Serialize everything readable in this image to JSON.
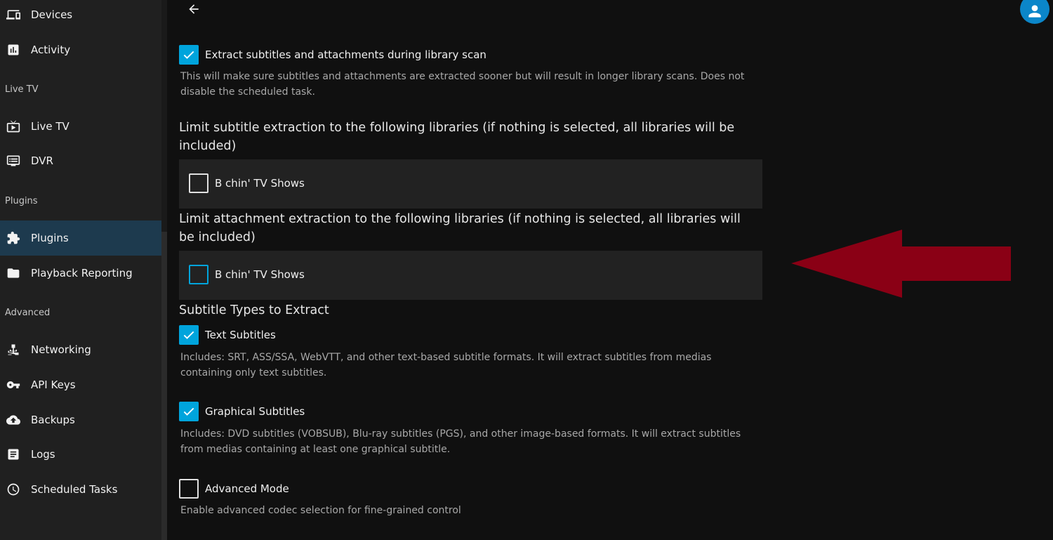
{
  "sidebar": {
    "items": [
      {
        "label": "Devices",
        "icon": "devices-icon"
      },
      {
        "label": "Activity",
        "icon": "activity-icon"
      },
      {
        "label": "Live TV",
        "icon": "live-tv-icon"
      },
      {
        "label": "DVR",
        "icon": "dvr-icon"
      },
      {
        "label": "Plugins",
        "icon": "puzzle-icon"
      },
      {
        "label": "Playback Reporting",
        "icon": "folder-icon"
      },
      {
        "label": "Networking",
        "icon": "network-icon"
      },
      {
        "label": "API Keys",
        "icon": "key-icon"
      },
      {
        "label": "Backups",
        "icon": "cloud-upload-icon"
      },
      {
        "label": "Logs",
        "icon": "document-icon"
      },
      {
        "label": "Scheduled Tasks",
        "icon": "clock-icon"
      }
    ],
    "sections": {
      "live_tv": "Live TV",
      "plugins": "Plugins",
      "advanced": "Advanced"
    },
    "active_item": "Plugins"
  },
  "main": {
    "extract_during_scan": {
      "label": "Extract subtitles and attachments during library scan",
      "checked": true,
      "description": "This will make sure subtitles and attachments are extracted sooner but will result in longer library scans. Does not disable the scheduled task."
    },
    "subtitle_limit_heading": "Limit subtitle extraction to the following libraries (if nothing is selected, all libraries will be included)",
    "subtitle_library": {
      "label": "B chin' TV Shows",
      "checked": false
    },
    "attachment_limit_heading": "Limit attachment extraction to the following libraries (if nothing is selected, all libraries will be included)",
    "attachment_library": {
      "label": "B chin' TV Shows",
      "checked": false
    },
    "subtitle_types_heading": "Subtitle Types to Extract",
    "text_subtitles": {
      "label": "Text Subtitles",
      "checked": true,
      "description": "Includes: SRT, ASS/SSA, WebVTT, and other text-based subtitle formats. It will extract subtitles from medias containing only text subtitles."
    },
    "graphical_subtitles": {
      "label": "Graphical Subtitles",
      "checked": true,
      "description": "Includes: DVD subtitles (VOBSUB), Blu-ray subtitles (PGS), and other image-based formats. It will extract subtitles from medias containing at least one graphical subtitle."
    },
    "advanced_mode": {
      "label": "Advanced Mode",
      "checked": false,
      "description": "Enable advanced codec selection for fine-grained control"
    }
  },
  "colors": {
    "accent": "#00a4dc",
    "arrow": "#8a0015",
    "active_nav": "#1d3a4e"
  }
}
